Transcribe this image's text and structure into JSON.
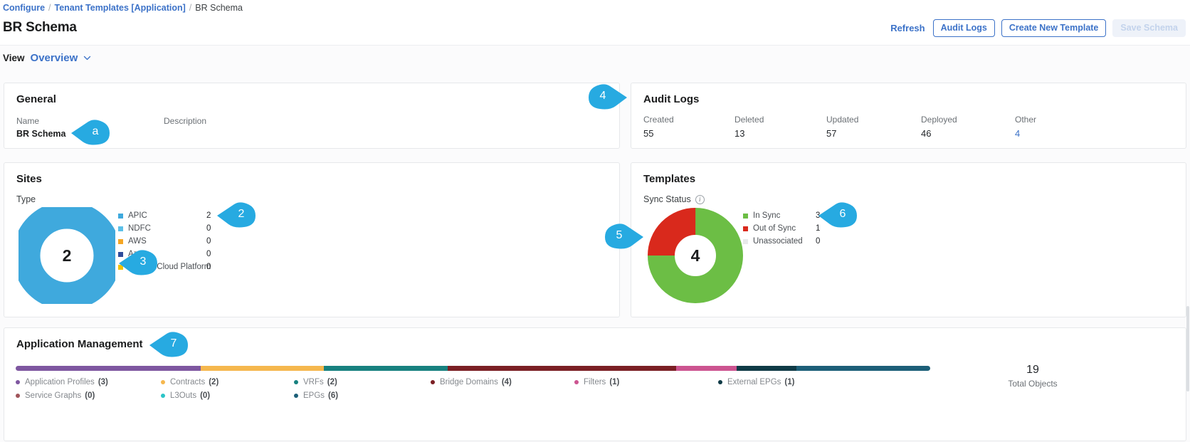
{
  "breadcrumb": {
    "items": [
      "Configure",
      "Tenant Templates [Application]",
      "BR Schema"
    ],
    "separator": "/"
  },
  "header": {
    "title": "BR Schema",
    "refresh_label": "Refresh",
    "audit_logs_label": "Audit Logs",
    "create_template_label": "Create New Template",
    "save_schema_label": "Save Schema"
  },
  "view": {
    "label": "View",
    "value": "Overview",
    "chevron_icon": "chevron-down-icon"
  },
  "general": {
    "title": "General",
    "name_label": "Name",
    "name_value": "BR Schema",
    "description_label": "Description",
    "description_value": ""
  },
  "audit_logs": {
    "title": "Audit Logs",
    "stats": [
      {
        "label": "Created",
        "value": "55",
        "link": false
      },
      {
        "label": "Deleted",
        "value": "13",
        "link": false
      },
      {
        "label": "Updated",
        "value": "57",
        "link": false
      },
      {
        "label": "Deployed",
        "value": "46",
        "link": false
      },
      {
        "label": "Other",
        "value": "4",
        "link": true
      }
    ]
  },
  "sites": {
    "title": "Sites",
    "type_label": "Type",
    "center_total": "2"
  },
  "templates": {
    "title": "Templates",
    "sync_status_label": "Sync Status",
    "info_icon": "info-icon",
    "center_total": "4"
  },
  "application_management": {
    "title": "Application Management",
    "total_value": "19",
    "total_label": "Total Objects"
  },
  "callouts": [
    {
      "id": "a",
      "text": "a",
      "direction": "left"
    },
    {
      "id": "2",
      "text": "2",
      "direction": "left"
    },
    {
      "id": "3",
      "text": "3",
      "direction": "left"
    },
    {
      "id": "4",
      "text": "4",
      "direction": "right"
    },
    {
      "id": "5",
      "text": "5",
      "direction": "right"
    },
    {
      "id": "6",
      "text": "6",
      "direction": "left"
    },
    {
      "id": "7",
      "text": "7",
      "direction": "left"
    }
  ],
  "colors": {
    "accent_blue": "#3c72c8",
    "callout_blue": "#27aae1",
    "apic": "#3fa9dd",
    "ndfc": "#5bc0e8",
    "aws": "#f5a623",
    "azure": "#2f4b9b",
    "gcp": "#f2c200",
    "in_sync": "#6cbe45",
    "out_of_sync": "#d9291c",
    "unassociated": "#e8e9ea"
  },
  "chart_data": [
    {
      "type": "pie",
      "title": "Sites",
      "subtitle": "Type",
      "center_label": "2",
      "legend_position": "right",
      "categories": [
        "APIC",
        "NDFC",
        "AWS",
        "Azure",
        "Google Cloud Platform"
      ],
      "values": [
        2,
        0,
        0,
        0,
        0
      ],
      "colors": [
        "#3fa9dd",
        "#5bc0e8",
        "#f5a623",
        "#2f4b9b",
        "#f2c200"
      ]
    },
    {
      "type": "pie",
      "title": "Templates",
      "subtitle": "Sync Status",
      "center_label": "4",
      "legend_position": "right",
      "categories": [
        "In Sync",
        "Out of Sync",
        "Unassociated"
      ],
      "values": [
        3,
        1,
        0
      ],
      "colors": [
        "#6cbe45",
        "#d9291c",
        "#e8e9ea"
      ]
    },
    {
      "type": "bar",
      "title": "Application Management",
      "orientation": "horizontal-stacked",
      "total": 19,
      "total_label": "Total Objects",
      "categories": [
        "Application Profiles",
        "Contracts",
        "VRFs",
        "Bridge Domains",
        "Filters",
        "External EPGs",
        "Service Graphs",
        "L3Outs",
        "EPGs"
      ],
      "values": [
        3,
        2,
        2,
        4,
        1,
        1,
        0,
        0,
        6
      ],
      "colors": [
        "#7e57a0",
        "#f5b74e",
        "#17817f",
        "#7b1f24",
        "#cc5490",
        "#0f3a46",
        "#a0545a",
        "#2bc4c7",
        "#1c5f78"
      ],
      "segments": [
        {
          "label": "Application Profiles",
          "value": 3,
          "color": "#7e57a0",
          "width_pct": 20.2
        },
        {
          "label": "Contracts",
          "value": 2,
          "color": "#f5b74e",
          "width_pct": 13.5
        },
        {
          "label": "VRFs",
          "value": 2,
          "color": "#17817f",
          "width_pct": 13.5
        },
        {
          "label": "Bridge Domains",
          "value": 4,
          "color": "#7b1f24",
          "width_pct": 25.0
        },
        {
          "label": "Filters",
          "value": 1,
          "color": "#cc5490",
          "width_pct": 6.6
        },
        {
          "label": "External EPGs",
          "value": 1,
          "color": "#0f3a46",
          "width_pct": 6.6
        },
        {
          "label": "EPGs",
          "value": 6,
          "color": "#1c5f78",
          "width_pct": 14.6
        }
      ]
    }
  ],
  "sites_legend": [
    {
      "name": "APIC",
      "value": "2",
      "color": "#3fa9dd"
    },
    {
      "name": "NDFC",
      "value": "0",
      "color": "#5bc0e8"
    },
    {
      "name": "AWS",
      "value": "0",
      "color": "#f5a623"
    },
    {
      "name": "Azure",
      "value": "0",
      "color": "#2f4b9b"
    },
    {
      "name": "Google Cloud Platform",
      "value": "0",
      "color": "#f2c200"
    }
  ],
  "templates_legend": [
    {
      "name": "In Sync",
      "value": "3",
      "color": "#6cbe45"
    },
    {
      "name": "Out of Sync",
      "value": "1",
      "color": "#d9291c"
    },
    {
      "name": "Unassociated",
      "value": "0",
      "color": "#e8e9ea"
    }
  ],
  "appmgmt_legend": [
    {
      "name": "Application Profiles",
      "count": "(3)",
      "color": "#7e57a0"
    },
    {
      "name": "Contracts",
      "count": "(2)",
      "color": "#f5b74e"
    },
    {
      "name": "VRFs",
      "count": "(2)",
      "color": "#17817f"
    },
    {
      "name": "Bridge Domains",
      "count": "(4)",
      "color": "#7b1f24"
    },
    {
      "name": "Filters",
      "count": "(1)",
      "color": "#cc5490"
    },
    {
      "name": "External EPGs",
      "count": "(1)",
      "color": "#0f3a46"
    },
    {
      "name": "Service Graphs",
      "count": "(0)",
      "color": "#a0545a"
    },
    {
      "name": "L3Outs",
      "count": "(0)",
      "color": "#2bc4c7"
    },
    {
      "name": "EPGs",
      "count": "(6)",
      "color": "#1c5f78"
    }
  ]
}
